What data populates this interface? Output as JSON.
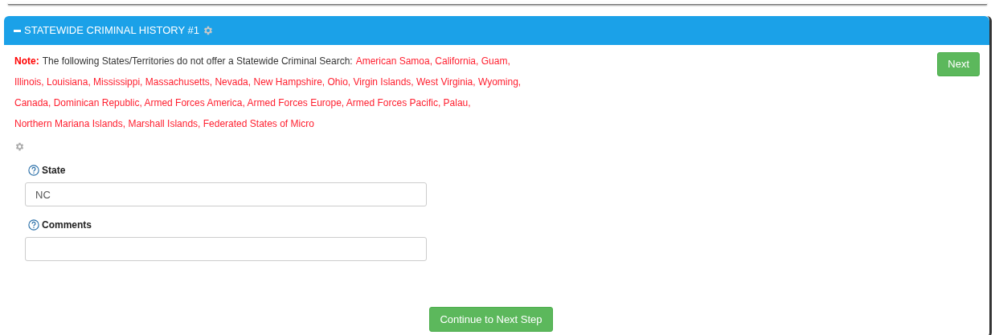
{
  "panel": {
    "title": "STATEWIDE CRIMINAL HISTORY #1",
    "expanded": true
  },
  "note": {
    "label": "Note:",
    "text": "The following States/Territories do not offer a Statewide Criminal Search:",
    "lines": [
      "American Samoa, California, Guam,",
      "Illinois, Louisiana, Mississippi, Massachusetts, Nevada, New Hampshire, Ohio, Virgin Islands, West Virginia, Wyoming,",
      "Canada, Dominican Republic, Armed Forces America, Armed Forces Europe, Armed Forces Pacific, Palau,",
      "Northern Mariana Islands, Marshall Islands, Federated States of Micro"
    ]
  },
  "next_button": "Next",
  "fields": [
    {
      "label": "State",
      "value": "NC"
    },
    {
      "label": "Comments"
    }
  ],
  "continue_button": "Continue to Next Step"
}
